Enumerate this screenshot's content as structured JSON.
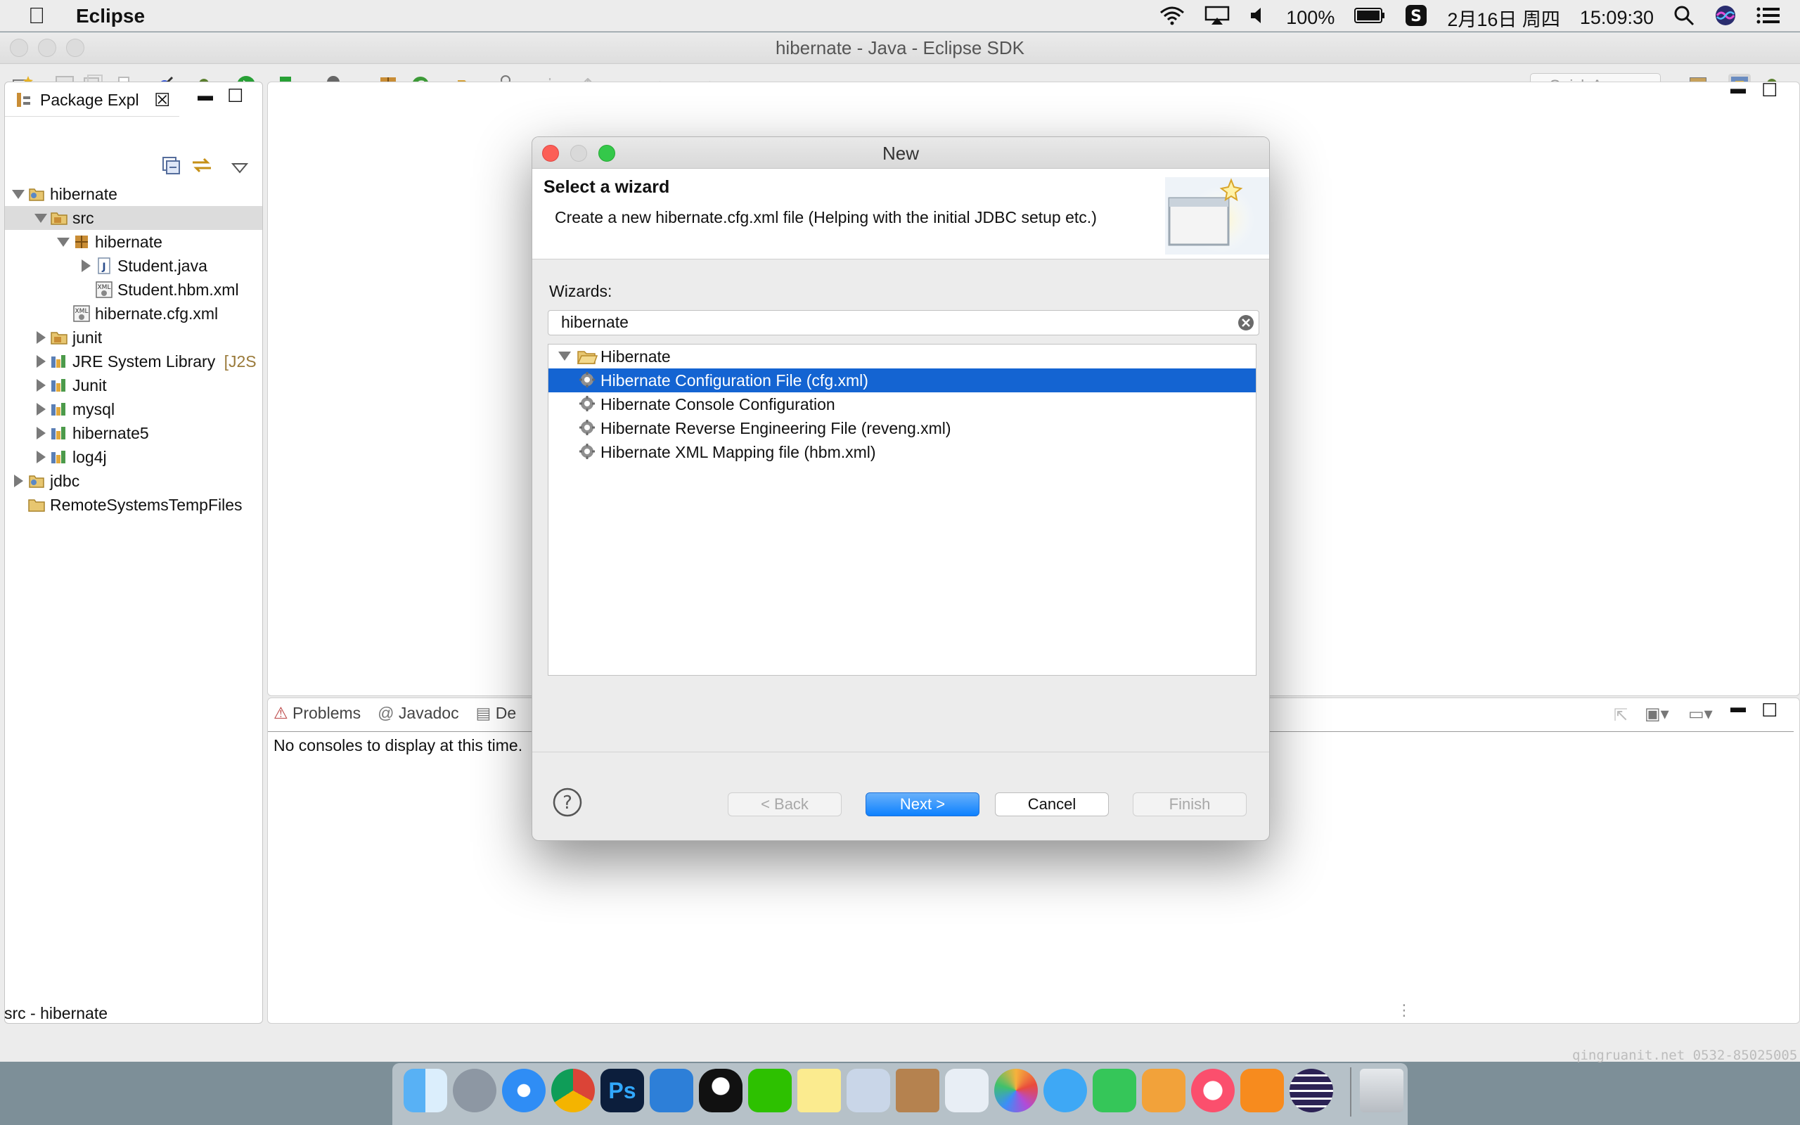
{
  "menubar": {
    "app_name": "Eclipse",
    "battery": "100%",
    "date": "2月16日 周四",
    "time": "15:09:30"
  },
  "window": {
    "title": "hibernate - Java - Eclipse SDK",
    "quick_access_placeholder": "Quick Access"
  },
  "package_explorer": {
    "tab_label": "Package Expl",
    "tree": [
      {
        "label": "hibernate",
        "indent": 0,
        "twisty": "open",
        "icon": "project-icon"
      },
      {
        "label": "src",
        "indent": 1,
        "twisty": "open",
        "icon": "source-folder-icon",
        "selected": true
      },
      {
        "label": "hibernate",
        "indent": 2,
        "twisty": "open",
        "icon": "package-icon"
      },
      {
        "label": "Student.java",
        "indent": 3,
        "twisty": "closed",
        "icon": "java-file-icon"
      },
      {
        "label": "Student.hbm.xml",
        "indent": 3,
        "twisty": "none",
        "icon": "xml-file-icon"
      },
      {
        "label": "hibernate.cfg.xml",
        "indent": 2,
        "twisty": "none",
        "icon": "xml-file-icon"
      },
      {
        "label": "junit",
        "indent": 1,
        "twisty": "closed",
        "icon": "source-folder-icon"
      },
      {
        "label": "JRE System Library",
        "suffix": "[J2S",
        "indent": 1,
        "twisty": "closed",
        "icon": "library-icon"
      },
      {
        "label": "Junit",
        "indent": 1,
        "twisty": "closed",
        "icon": "library-icon"
      },
      {
        "label": "mysql",
        "indent": 1,
        "twisty": "closed",
        "icon": "library-icon"
      },
      {
        "label": "hibernate5",
        "indent": 1,
        "twisty": "closed",
        "icon": "library-icon"
      },
      {
        "label": "log4j",
        "indent": 1,
        "twisty": "closed",
        "icon": "library-icon"
      },
      {
        "label": "jdbc",
        "indent": 0,
        "twisty": "closed",
        "icon": "project-icon"
      },
      {
        "label": "RemoteSystemsTempFiles",
        "indent": 0,
        "twisty": "none",
        "icon": "folder-icon"
      }
    ]
  },
  "console_view": {
    "tabs": [
      "Problems",
      "Javadoc",
      "De"
    ],
    "message": "No consoles to display at this time."
  },
  "status_bar": {
    "text": "src - hibernate"
  },
  "watermark": "qingruanit.net 0532-85025005",
  "dialog": {
    "title": "New",
    "header_title": "Select a wizard",
    "header_description": "Create a new hibernate.cfg.xml file (Helping with the initial JDBC setup etc.)",
    "wizards_label": "Wizards:",
    "filter_value": "hibernate",
    "tree_root": "Hibernate",
    "tree_items": [
      "Hibernate Configuration File (cfg.xml)",
      "Hibernate Console Configuration",
      "Hibernate Reverse Engineering File (reveng.xml)",
      "Hibernate XML Mapping file (hbm.xml)"
    ],
    "selected_index": 0,
    "buttons": {
      "back": "< Back",
      "next": "Next >",
      "cancel": "Cancel",
      "finish": "Finish"
    }
  },
  "colors": {
    "selection": "#1464d2",
    "accent": "#0d81ff"
  }
}
